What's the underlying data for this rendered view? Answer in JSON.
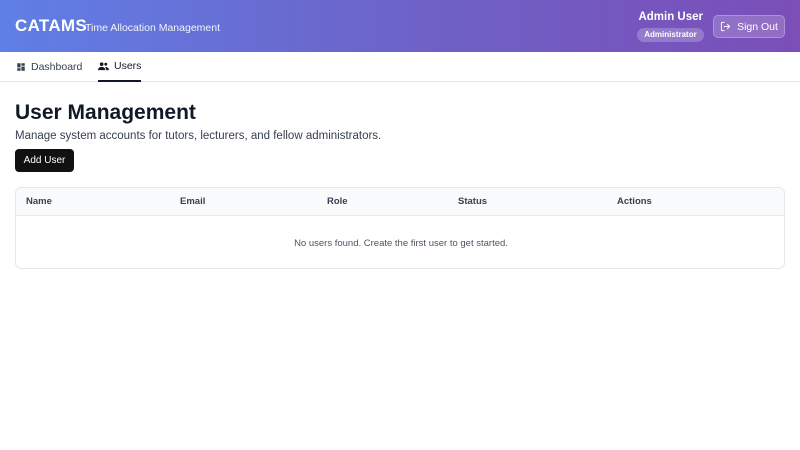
{
  "header": {
    "brand": "CATAMS",
    "tagline": "Time Allocation Management",
    "user_name": "Admin User",
    "user_role": "Administrator",
    "signout_label": "Sign Out"
  },
  "nav": {
    "tabs": [
      {
        "label": "Dashboard",
        "icon": "dashboard-icon",
        "active": false
      },
      {
        "label": "Users",
        "icon": "users-icon",
        "active": true
      }
    ]
  },
  "main": {
    "title": "User Management",
    "subtitle": "Manage system accounts for tutors, lecturers, and fellow administrators.",
    "add_user_label": "Add User"
  },
  "table": {
    "columns": [
      "Name",
      "Email",
      "Role",
      "Status",
      "Actions"
    ],
    "rows": [],
    "empty_message": "No users found. Create the first user to get started."
  },
  "colors": {
    "header_gradient_start": "#5f7fe6",
    "header_gradient_end": "#7b4eb8",
    "primary_button": "#111111"
  }
}
